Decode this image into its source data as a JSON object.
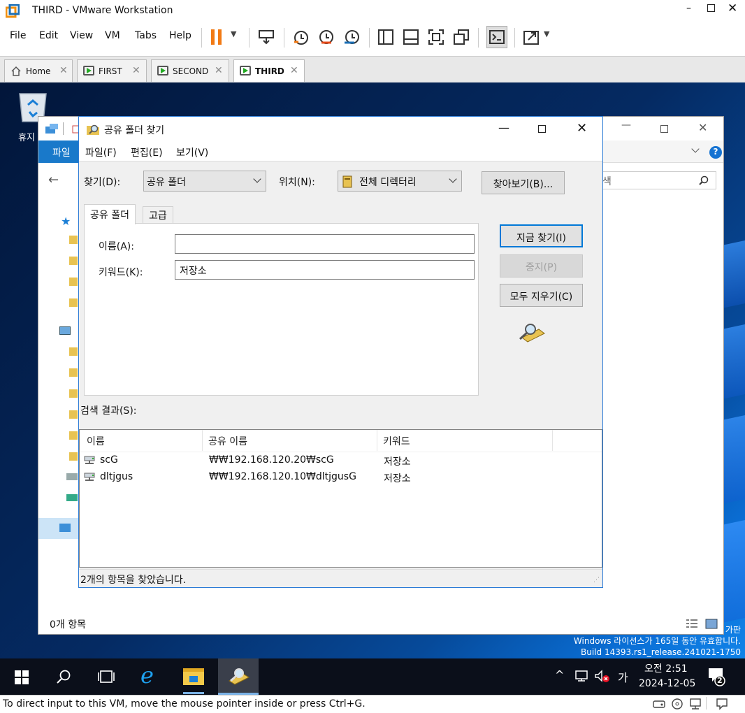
{
  "app": {
    "title": "THIRD - VMware Workstation"
  },
  "menubar": {
    "items": [
      "File",
      "Edit",
      "View",
      "VM",
      "Tabs",
      "Help"
    ]
  },
  "tabs": [
    {
      "label": "Home"
    },
    {
      "label": "FIRST"
    },
    {
      "label": "SECOND"
    },
    {
      "label": "THIRD",
      "active": true
    }
  ],
  "desktop": {
    "recycle_label": "휴지"
  },
  "explorer": {
    "file_tab": "파일",
    "search_placeholder": "색",
    "status": "0개 항목"
  },
  "dialog": {
    "title": "공유 폴더 찾기",
    "menu": [
      "파일(F)",
      "편집(E)",
      "보기(V)"
    ],
    "find_label": "찾기(D):",
    "find_value": "공유 폴더",
    "location_label": "위치(N):",
    "location_value": "전체 디렉터리",
    "browse_button": "찾아보기(B)...",
    "tabs": [
      "공유 폴더",
      "고급"
    ],
    "name_label": "이름(A):",
    "name_value": "",
    "keyword_label": "키워드(K):",
    "keyword_value": "저장소",
    "find_now_button": "지금 찾기(I)",
    "stop_button": "중지(P)",
    "clear_all_button": "모두 지우기(C)",
    "results_label": "검색 결과(S):",
    "columns": [
      "이름",
      "공유 이름",
      "키워드"
    ],
    "rows": [
      {
        "name": "scG",
        "share": "₩₩192.168.120.20₩scG",
        "keyword": "저장소"
      },
      {
        "name": "dltjgus",
        "share": "₩₩192.168.120.10₩dltjgusG",
        "keyword": "저장소"
      }
    ],
    "status": "2개의 항목을 찾았습니다."
  },
  "watermark": {
    "edition": "가판",
    "license": "Windows 라이선스가 165일 동안 유효합니다.",
    "build": "Build 14393.rs1_release.241021-1750"
  },
  "taskbar": {
    "ime": "가",
    "time": "오전 2:51",
    "date": "2024-12-05",
    "notifications": "2"
  },
  "vm_status": "To direct input to this VM, move the mouse pointer inside or press Ctrl+G."
}
